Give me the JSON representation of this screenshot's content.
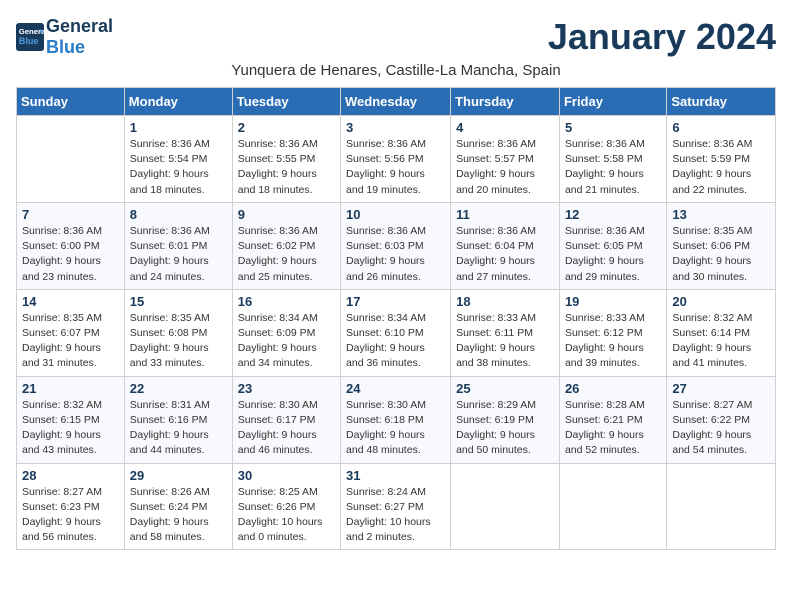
{
  "header": {
    "logo_general": "General",
    "logo_blue": "Blue",
    "month_title": "January 2024",
    "subtitle": "Yunquera de Henares, Castille-La Mancha, Spain"
  },
  "columns": [
    "Sunday",
    "Monday",
    "Tuesday",
    "Wednesday",
    "Thursday",
    "Friday",
    "Saturday"
  ],
  "weeks": [
    [
      {
        "day": "",
        "info": ""
      },
      {
        "day": "1",
        "info": "Sunrise: 8:36 AM\nSunset: 5:54 PM\nDaylight: 9 hours\nand 18 minutes."
      },
      {
        "day": "2",
        "info": "Sunrise: 8:36 AM\nSunset: 5:55 PM\nDaylight: 9 hours\nand 18 minutes."
      },
      {
        "day": "3",
        "info": "Sunrise: 8:36 AM\nSunset: 5:56 PM\nDaylight: 9 hours\nand 19 minutes."
      },
      {
        "day": "4",
        "info": "Sunrise: 8:36 AM\nSunset: 5:57 PM\nDaylight: 9 hours\nand 20 minutes."
      },
      {
        "day": "5",
        "info": "Sunrise: 8:36 AM\nSunset: 5:58 PM\nDaylight: 9 hours\nand 21 minutes."
      },
      {
        "day": "6",
        "info": "Sunrise: 8:36 AM\nSunset: 5:59 PM\nDaylight: 9 hours\nand 22 minutes."
      }
    ],
    [
      {
        "day": "7",
        "info": "Sunrise: 8:36 AM\nSunset: 6:00 PM\nDaylight: 9 hours\nand 23 minutes."
      },
      {
        "day": "8",
        "info": "Sunrise: 8:36 AM\nSunset: 6:01 PM\nDaylight: 9 hours\nand 24 minutes."
      },
      {
        "day": "9",
        "info": "Sunrise: 8:36 AM\nSunset: 6:02 PM\nDaylight: 9 hours\nand 25 minutes."
      },
      {
        "day": "10",
        "info": "Sunrise: 8:36 AM\nSunset: 6:03 PM\nDaylight: 9 hours\nand 26 minutes."
      },
      {
        "day": "11",
        "info": "Sunrise: 8:36 AM\nSunset: 6:04 PM\nDaylight: 9 hours\nand 27 minutes."
      },
      {
        "day": "12",
        "info": "Sunrise: 8:36 AM\nSunset: 6:05 PM\nDaylight: 9 hours\nand 29 minutes."
      },
      {
        "day": "13",
        "info": "Sunrise: 8:35 AM\nSunset: 6:06 PM\nDaylight: 9 hours\nand 30 minutes."
      }
    ],
    [
      {
        "day": "14",
        "info": "Sunrise: 8:35 AM\nSunset: 6:07 PM\nDaylight: 9 hours\nand 31 minutes."
      },
      {
        "day": "15",
        "info": "Sunrise: 8:35 AM\nSunset: 6:08 PM\nDaylight: 9 hours\nand 33 minutes."
      },
      {
        "day": "16",
        "info": "Sunrise: 8:34 AM\nSunset: 6:09 PM\nDaylight: 9 hours\nand 34 minutes."
      },
      {
        "day": "17",
        "info": "Sunrise: 8:34 AM\nSunset: 6:10 PM\nDaylight: 9 hours\nand 36 minutes."
      },
      {
        "day": "18",
        "info": "Sunrise: 8:33 AM\nSunset: 6:11 PM\nDaylight: 9 hours\nand 38 minutes."
      },
      {
        "day": "19",
        "info": "Sunrise: 8:33 AM\nSunset: 6:12 PM\nDaylight: 9 hours\nand 39 minutes."
      },
      {
        "day": "20",
        "info": "Sunrise: 8:32 AM\nSunset: 6:14 PM\nDaylight: 9 hours\nand 41 minutes."
      }
    ],
    [
      {
        "day": "21",
        "info": "Sunrise: 8:32 AM\nSunset: 6:15 PM\nDaylight: 9 hours\nand 43 minutes."
      },
      {
        "day": "22",
        "info": "Sunrise: 8:31 AM\nSunset: 6:16 PM\nDaylight: 9 hours\nand 44 minutes."
      },
      {
        "day": "23",
        "info": "Sunrise: 8:30 AM\nSunset: 6:17 PM\nDaylight: 9 hours\nand 46 minutes."
      },
      {
        "day": "24",
        "info": "Sunrise: 8:30 AM\nSunset: 6:18 PM\nDaylight: 9 hours\nand 48 minutes."
      },
      {
        "day": "25",
        "info": "Sunrise: 8:29 AM\nSunset: 6:19 PM\nDaylight: 9 hours\nand 50 minutes."
      },
      {
        "day": "26",
        "info": "Sunrise: 8:28 AM\nSunset: 6:21 PM\nDaylight: 9 hours\nand 52 minutes."
      },
      {
        "day": "27",
        "info": "Sunrise: 8:27 AM\nSunset: 6:22 PM\nDaylight: 9 hours\nand 54 minutes."
      }
    ],
    [
      {
        "day": "28",
        "info": "Sunrise: 8:27 AM\nSunset: 6:23 PM\nDaylight: 9 hours\nand 56 minutes."
      },
      {
        "day": "29",
        "info": "Sunrise: 8:26 AM\nSunset: 6:24 PM\nDaylight: 9 hours\nand 58 minutes."
      },
      {
        "day": "30",
        "info": "Sunrise: 8:25 AM\nSunset: 6:26 PM\nDaylight: 10 hours\nand 0 minutes."
      },
      {
        "day": "31",
        "info": "Sunrise: 8:24 AM\nSunset: 6:27 PM\nDaylight: 10 hours\nand 2 minutes."
      },
      {
        "day": "",
        "info": ""
      },
      {
        "day": "",
        "info": ""
      },
      {
        "day": "",
        "info": ""
      }
    ]
  ]
}
